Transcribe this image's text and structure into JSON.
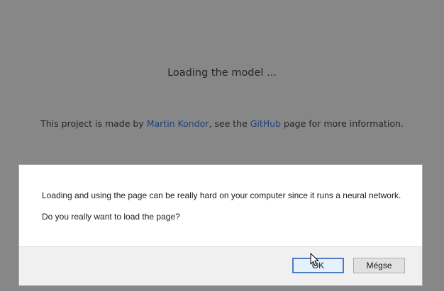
{
  "page": {
    "loading_text": "Loading the model ...",
    "info": {
      "prefix": "This project is made by ",
      "author_link": "Martin Kondor",
      "middle": ", see the ",
      "github_link": "GitHub",
      "suffix": " page for more information."
    }
  },
  "dialog": {
    "message_line1": "Loading and using the page can be really hard on your computer since it runs a neural network.",
    "message_line2": "Do you really want to load the page?",
    "ok_label": "OK",
    "cancel_label": "Mégse"
  },
  "colors": {
    "overlay": "#878787",
    "link": "#1f3f7a",
    "focus_border": "#4a7cc4"
  }
}
